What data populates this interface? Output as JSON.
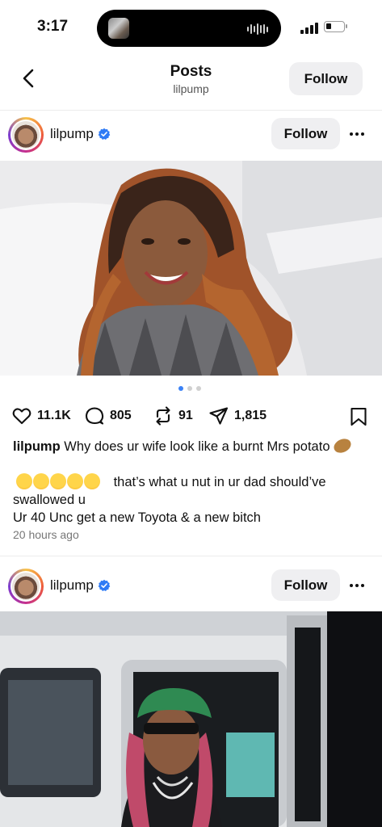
{
  "status_bar": {
    "time": "3:17"
  },
  "header": {
    "title": "Posts",
    "subtitle": "lilpump",
    "follow_label": "Follow"
  },
  "posts": [
    {
      "username": "lilpump",
      "follow_label": "Follow",
      "carousel": {
        "count": 3,
        "active": 1
      },
      "likes": "11.1K",
      "comments": "805",
      "reposts": "91",
      "shares": "1,815",
      "caption_user": "lilpump",
      "caption_text": "Why does ur wife look like a burnt Mrs potato",
      "caption_line2": "that’s what u nut in ur dad should’ve swallowed u",
      "caption_line3": "Ur 40 Unc  get a new Toyota & a new bitch",
      "time_ago": "20 hours ago"
    },
    {
      "username": "lilpump",
      "follow_label": "Follow"
    }
  ],
  "colors": {
    "accent_blue": "#3b82f6",
    "verified": "#2f7bf5",
    "button_bg": "#efeff1"
  }
}
